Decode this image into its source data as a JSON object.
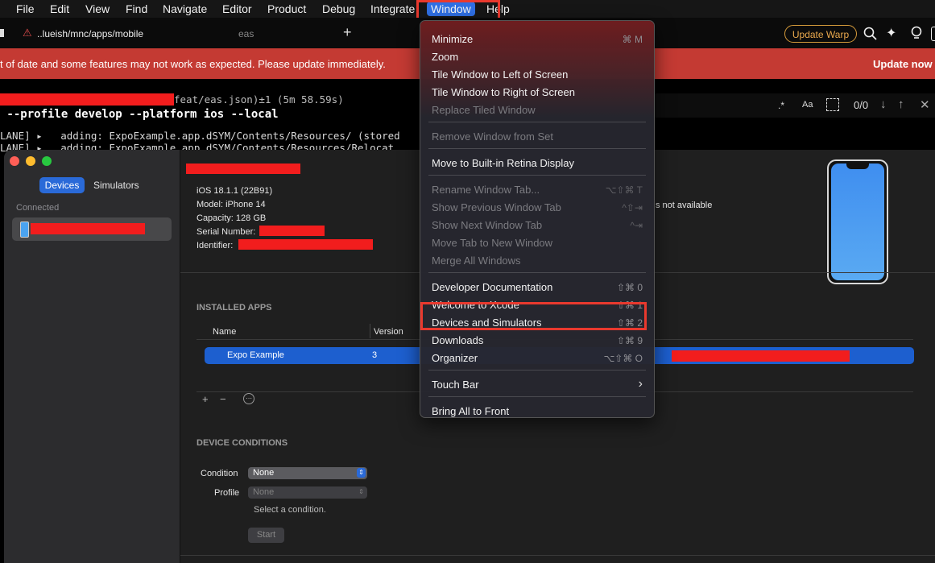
{
  "menubar": {
    "items": [
      "File",
      "Edit",
      "View",
      "Find",
      "Navigate",
      "Editor",
      "Product",
      "Debug",
      "Integrate",
      "Window",
      "Help"
    ]
  },
  "terminal": {
    "tab_active": "..lueish/mnc/apps/mobile",
    "tab_other": "eas",
    "plus": "+",
    "update_button": "Update Warp",
    "banner_text": "t of date and some features may not work as expected. Please update immediately.",
    "banner_action": "Update now",
    "prompt_suffix": "feat/eas.json)±1 (5m 58.59s)",
    "command": " --profile develop --platform ios --local",
    "line1": "LANE] ▸   adding: ExpoExample.app.dSYM/Contents/Resources/ (stored",
    "line2": "LANE] ▸   adding: ExpoExample.app.dSYM/Contents/Resources/Relocat",
    "find_counter": "0/0",
    "find_icons": [
      ".*",
      "Aa"
    ]
  },
  "devices_window": {
    "tabs": [
      "Devices",
      "Simulators"
    ],
    "sidebar_header": "Connected",
    "device_info": {
      "os": "iOS 18.1.1 (22B91)",
      "model": "Model: iPhone 14",
      "capacity": "Capacity: 128 GB",
      "serial_label": "Serial Number:",
      "identifier_label": "Identifier:"
    },
    "not_available": "s not available",
    "installed_apps": {
      "title": "INSTALLED APPS",
      "columns": [
        "Name",
        "Version"
      ],
      "rows": [
        {
          "name": "Expo Example",
          "version": "3"
        }
      ],
      "actions": [
        "+",
        "−",
        "⋯"
      ]
    },
    "conditions": {
      "title": "DEVICE CONDITIONS",
      "condition_label": "Condition",
      "condition_value": "None",
      "profile_label": "Profile",
      "profile_value": "None",
      "hint": "Select a condition.",
      "start_button": "Start"
    }
  },
  "window_menu": {
    "items": [
      {
        "label": "Minimize",
        "shortcut": "⌘ M",
        "enabled": true
      },
      {
        "label": "Zoom",
        "shortcut": "",
        "enabled": true
      },
      {
        "label": "Tile Window to Left of Screen",
        "shortcut": "",
        "enabled": true
      },
      {
        "label": "Tile Window to Right of Screen",
        "shortcut": "",
        "enabled": true
      },
      {
        "label": "Replace Tiled Window",
        "shortcut": "",
        "enabled": false
      },
      {
        "label": "Remove Window from Set",
        "shortcut": "",
        "enabled": false
      },
      {
        "label": "Move to Built-in Retina Display",
        "shortcut": "",
        "enabled": true
      },
      {
        "label": "Rename Window Tab...",
        "shortcut": "⌥⇧⌘ T",
        "enabled": false
      },
      {
        "label": "Show Previous Window Tab",
        "shortcut": "^⇧⇥",
        "enabled": false
      },
      {
        "label": "Show Next Window Tab",
        "shortcut": "^⇥",
        "enabled": false
      },
      {
        "label": "Move Tab to New Window",
        "shortcut": "",
        "enabled": false
      },
      {
        "label": "Merge All Windows",
        "shortcut": "",
        "enabled": false
      },
      {
        "label": "Developer Documentation",
        "shortcut": "⇧⌘ 0",
        "enabled": true
      },
      {
        "label": "Welcome to Xcode",
        "shortcut": "⇧⌘ 1",
        "enabled": true
      },
      {
        "label": "Devices and Simulators",
        "shortcut": "⇧⌘ 2",
        "enabled": true
      },
      {
        "label": "Downloads",
        "shortcut": "⇧⌘ 9",
        "enabled": true
      },
      {
        "label": "Organizer",
        "shortcut": "⌥⇧⌘ O",
        "enabled": true
      },
      {
        "label": "Touch Bar",
        "shortcut": "›",
        "enabled": true
      },
      {
        "label": "Bring All to Front",
        "shortcut": "",
        "enabled": true
      }
    ]
  },
  "colors": {
    "accent": "#2a6ad8",
    "highlight_box": "#e9392e",
    "banner": "#c43a33",
    "redaction": "#f21d1d"
  }
}
